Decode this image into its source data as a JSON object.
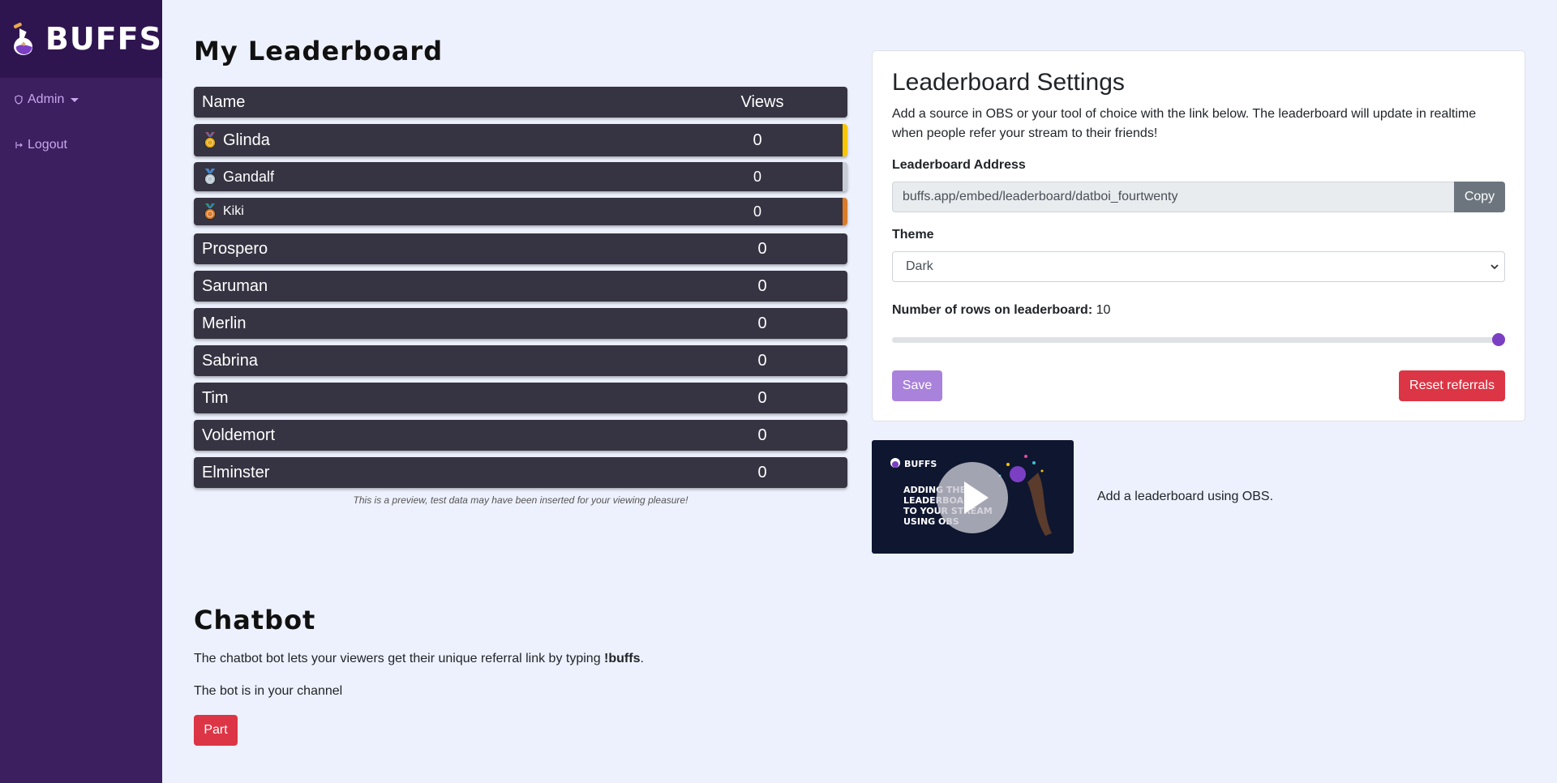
{
  "brand": {
    "name": "BUFFS"
  },
  "sidebar": {
    "admin_label": "Admin",
    "logout_label": "Logout"
  },
  "leaderboard": {
    "title": "My Leaderboard",
    "col_name": "Name",
    "col_views": "Views",
    "rows": [
      {
        "name": "Glinda",
        "views": "0",
        "medal": "gold",
        "accent": "#f7c600"
      },
      {
        "name": "Gandalf",
        "views": "0",
        "medal": "silver",
        "accent": "#c8ccd4"
      },
      {
        "name": "Kiki",
        "views": "0",
        "medal": "bronze",
        "accent": "#d97b2b"
      },
      {
        "name": "Prospero",
        "views": "0"
      },
      {
        "name": "Saruman",
        "views": "0"
      },
      {
        "name": "Merlin",
        "views": "0"
      },
      {
        "name": "Sabrina",
        "views": "0"
      },
      {
        "name": "Tim",
        "views": "0"
      },
      {
        "name": "Voldemort",
        "views": "0"
      },
      {
        "name": "Elminster",
        "views": "0"
      }
    ],
    "caption": "This is a preview, test data may have been inserted for your viewing pleasure!"
  },
  "settings": {
    "title": "Leaderboard Settings",
    "description": "Add a source in OBS or your tool of choice with the link below. The leaderboard will update in realtime when people refer your stream to their friends!",
    "address_label": "Leaderboard Address",
    "address_value": "buffs.app/embed/leaderboard/datboi_fourtwenty",
    "copy_label": "Copy",
    "theme_label": "Theme",
    "theme_value": "Dark",
    "rows_label": "Number of rows on leaderboard:",
    "rows_value": "10",
    "rows_slider_fraction": 1.0,
    "save_label": "Save",
    "reset_label": "Reset referrals"
  },
  "video": {
    "brand": "BUFFS",
    "title_lines": [
      "ADDING THE",
      "LEADERBOARD",
      "TO YOUR STREAM",
      "USING OBS"
    ],
    "caption": "Add a leaderboard using OBS."
  },
  "chatbot": {
    "title": "Chatbot",
    "desc_prefix": "The chatbot bot lets your viewers get their unique referral link by typing ",
    "desc_command": "!buffs",
    "desc_suffix": ".",
    "status": "The bot is in your channel",
    "part_label": "Part"
  },
  "colors": {
    "sidebar": "#3c1f5e",
    "accent_purple": "#7b3fc4",
    "danger": "#dc3545",
    "save": "#a982dc",
    "row_bg": "#363442"
  },
  "icons": [
    "potion-logo-icon",
    "shield-icon",
    "logout-icon",
    "play-icon",
    "medal-icon",
    "chevron-down-icon"
  ]
}
